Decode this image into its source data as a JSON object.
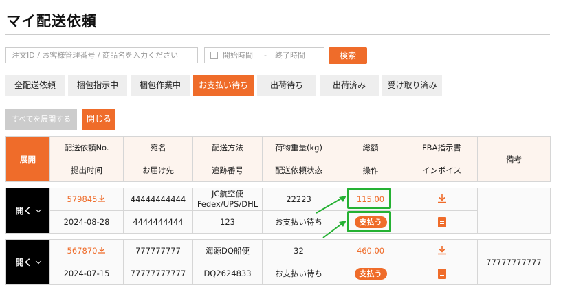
{
  "page": {
    "title": "マイ配送依頼"
  },
  "search": {
    "placeholder": "注文ID / お客様管理番号 / 商品名を入力ください",
    "date_start": "開始時間",
    "date_sep": "-",
    "date_end": "終了時間",
    "button": "検索"
  },
  "tabs": [
    {
      "label": "全配送依頼",
      "active": false
    },
    {
      "label": "梱包指示中",
      "active": false
    },
    {
      "label": "梱包作業中",
      "active": false
    },
    {
      "label": "お支払い待ち",
      "active": true
    },
    {
      "label": "出荷待ち",
      "active": false
    },
    {
      "label": "出荷済み",
      "active": false
    },
    {
      "label": "受け取り済み",
      "active": false
    }
  ],
  "actions": {
    "expand_all": "すべてを展開する",
    "close": "閉じる"
  },
  "header": {
    "expand": "展開",
    "row1": [
      "配送依頼No.",
      "宛名",
      "配送方法",
      "荷物重量(kg)",
      "総額",
      "FBA指示書"
    ],
    "row2": [
      "提出时间",
      "お届け先",
      "追跡番号",
      "配送依頼状态",
      "操作",
      "インボイス"
    ],
    "note": "備考"
  },
  "orders": [
    {
      "toggle": "開く",
      "number": "579845",
      "name": "44444444444",
      "method_line1": "JC航空便",
      "method_line2": "Fedex/UPS/DHL",
      "weight": "22223",
      "total": "115.00",
      "date": "2024-08-28",
      "destination": "4444444444",
      "tracking": "123",
      "status": "お支払い待ち",
      "pay": "支払う",
      "note": ""
    },
    {
      "toggle": "開く",
      "number": "567870",
      "name": "777777777",
      "method_line1": "海源DQ船便",
      "method_line2": "",
      "weight": "32",
      "total": "460.00",
      "date": "2024-07-15",
      "destination": "77777777777",
      "tracking": "DQ2624833",
      "status": "お支払い待ち",
      "pay": "支払う",
      "note": "77777777777"
    }
  ],
  "icons": {
    "download": "download-icon",
    "document": "invoice-document-icon",
    "calendar": "calendar-icon",
    "chevron": "chevron-down-icon"
  },
  "colors": {
    "accent": "#ef6c2a",
    "highlight": "#25b133",
    "header_bg": "#fdf4ee"
  }
}
